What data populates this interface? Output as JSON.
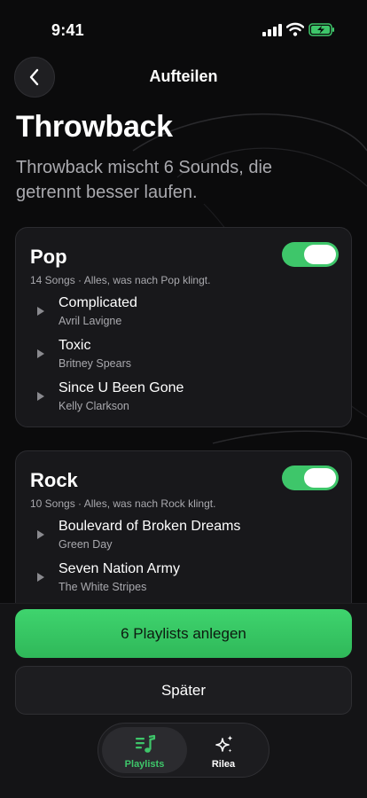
{
  "status_bar": {
    "time": "9:41"
  },
  "nav": {
    "title": "Aufteilen"
  },
  "page": {
    "title": "Throwback",
    "subtitle": "Throwback mischt 6 Sounds, die getrennt besser laufen."
  },
  "groups": [
    {
      "name": "Pop",
      "meta": "14 Songs · Alles, was nach Pop klingt.",
      "enabled": true,
      "songs": [
        {
          "title": "Complicated",
          "artist": "Avril Lavigne"
        },
        {
          "title": "Toxic",
          "artist": "Britney Spears"
        },
        {
          "title": "Since U Been Gone",
          "artist": "Kelly Clarkson"
        }
      ]
    },
    {
      "name": "Rock",
      "meta": "10 Songs · Alles, was nach Rock klingt.",
      "enabled": true,
      "songs": [
        {
          "title": "Boulevard of Broken Dreams",
          "artist": "Green Day"
        },
        {
          "title": "Seven Nation Army",
          "artist": "The White Stripes"
        }
      ]
    }
  ],
  "actions": {
    "primary_label": "6 Playlists anlegen",
    "secondary_label": "Später"
  },
  "tab_bar": {
    "tabs": [
      {
        "label": "Playlists",
        "icon": "music-list-icon",
        "active": true
      },
      {
        "label": "Rilea",
        "icon": "sparkles-icon",
        "active": false
      }
    ]
  },
  "colors": {
    "accent": "#3ec66a",
    "background": "#0b0b0c",
    "card": "#18181b",
    "secondary_text": "#a9a9ae"
  }
}
